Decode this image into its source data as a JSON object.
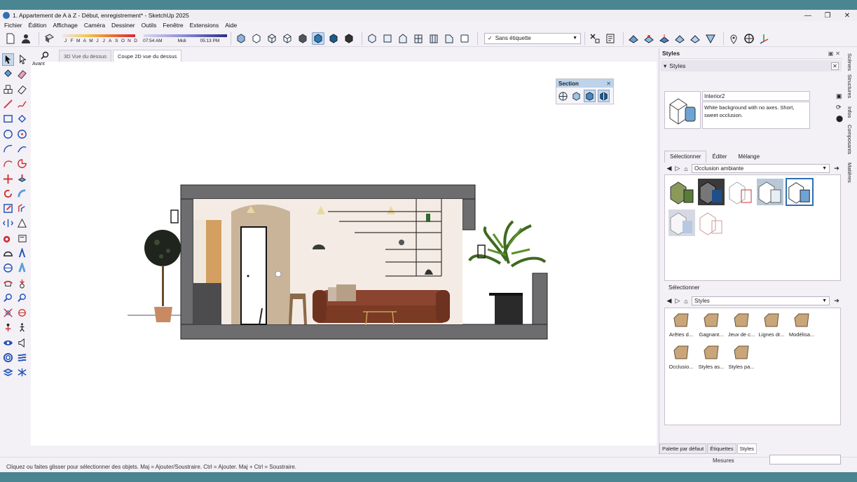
{
  "window": {
    "title": "1. Appartement de A à Z - Début, enregistrement* - SketchUp 2025",
    "controls": [
      "—",
      "❐",
      "✕"
    ]
  },
  "menu": [
    "Fichier",
    "Édition",
    "Affichage",
    "Caméra",
    "Dessiner",
    "Outils",
    "Fenêtre",
    "Extensions",
    "Aide"
  ],
  "shadow": {
    "months": [
      "J",
      "F",
      "M",
      "A",
      "M",
      "J",
      "J",
      "A",
      "S",
      "O",
      "N",
      "D"
    ],
    "time_start": "07:54 AM",
    "time_mid": "Midi",
    "time_end": "05:13 PM"
  },
  "tag_select": {
    "check": "✓",
    "value": "Sans étiquette"
  },
  "scene_tabs": [
    "3D Vue du dessus",
    "Coupe 2D vue du dessus"
  ],
  "view_label": "Avant",
  "section_panel": {
    "title": "Section",
    "close": "✕"
  },
  "tray": {
    "title": "Styles",
    "sub_title": "Styles",
    "style_name": "Interior2",
    "style_desc": "White background with no axes. Short, sweet occlusion.",
    "tabs": [
      "Sélectionner",
      "Éditer",
      "Mélange"
    ],
    "collection1": "Occlusion ambiante",
    "select_label": "Sélectionner",
    "collection2": "Styles",
    "folders": [
      "Arêtes d...",
      "Gagnant...",
      "Jeux de c...",
      "Lignes dr...",
      "Modélisa...",
      "Occlusio...",
      "Styles as...",
      "Styles pa..."
    ],
    "bottom_tabs": [
      "Palette par défaut",
      "Étiquettes",
      "Styles"
    ]
  },
  "vertical_tabs": [
    "Scènes",
    "Structures",
    "Infos",
    "Composants",
    "Matières"
  ],
  "status": {
    "message": "Cliquez ou faites glisser pour sélectionner des objets. Maj = Ajouter/Soustraire. Ctrl = Ajouter. Maj + Ctrl = Soustraire.",
    "measure_label": "Mesures"
  }
}
